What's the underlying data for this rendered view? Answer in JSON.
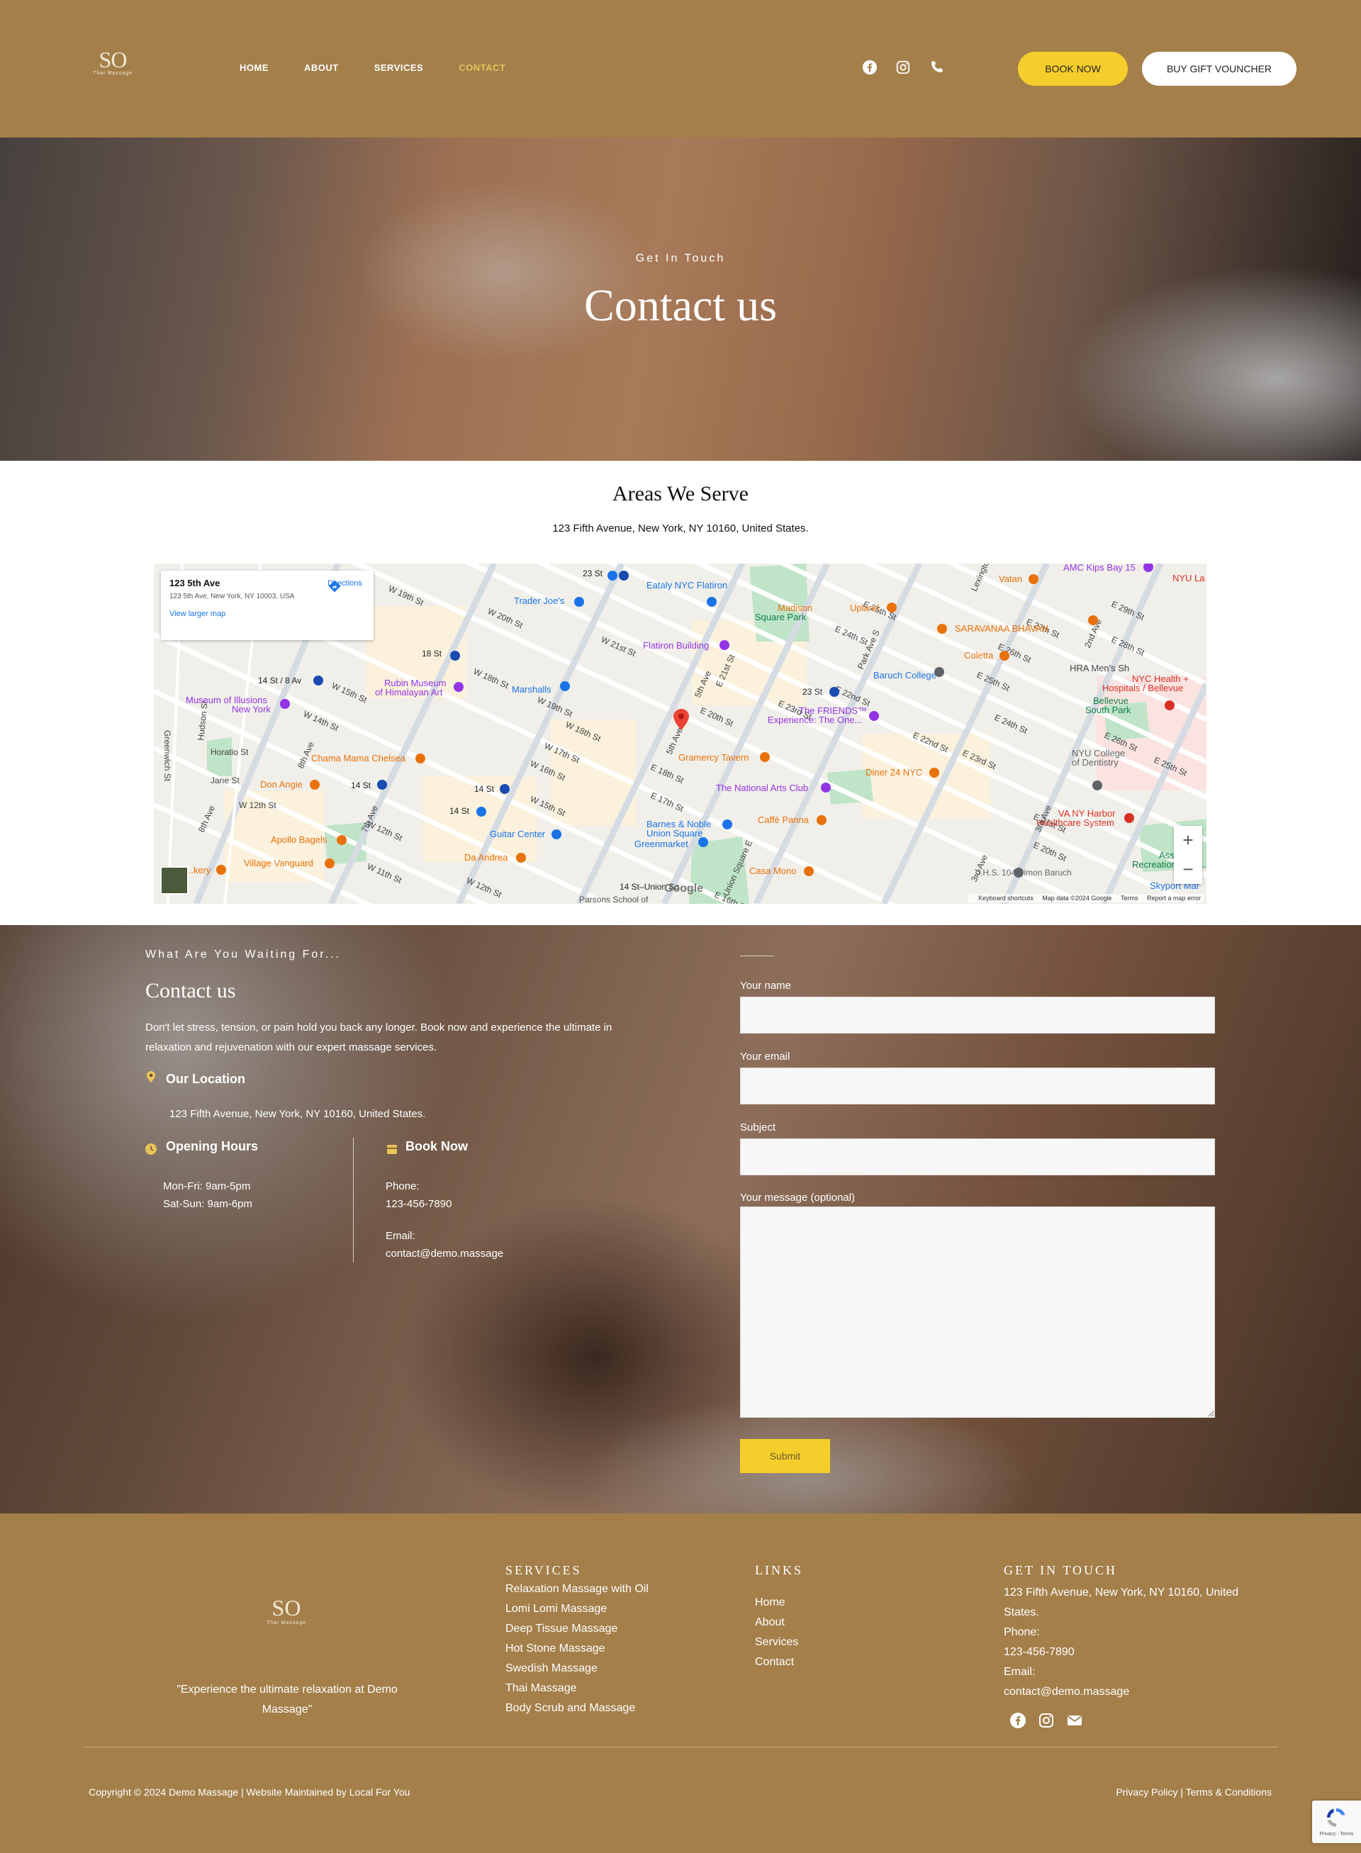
{
  "brand": {
    "monogram": "SO",
    "tagline": "Thai Massage"
  },
  "nav": {
    "items": [
      {
        "label": "HOME",
        "active": false
      },
      {
        "label": "ABOUT",
        "active": false
      },
      {
        "label": "SERVICES",
        "active": false
      },
      {
        "label": "CONTACT",
        "active": true
      }
    ]
  },
  "header_icons": [
    "facebook-icon",
    "instagram-icon",
    "phone-icon"
  ],
  "header_buttons": {
    "book": "BOOK NOW",
    "gift": "BUY GIFT VOUNCHER"
  },
  "hero": {
    "eyebrow": "Get In Touch",
    "title": "Contact us"
  },
  "areas": {
    "title": "Areas We Serve",
    "address": "123 Fifth Avenue, New York, NY 10160, United States."
  },
  "map": {
    "card_title": "123 5th Ave",
    "card_address": "123 5th Ave, New York, NY 10003, USA",
    "view_larger": "View larger map",
    "directions": "Directions",
    "zoom_in": "+",
    "zoom_out": "−",
    "brand": "Google",
    "footer": {
      "shortcuts": "Keyboard shortcuts",
      "data": "Map data ©2024 Google",
      "terms": "Terms",
      "report": "Report a map error"
    },
    "places": [
      "Trader Joe's",
      "Eataly NYC Flatiron",
      "Madison Square Park",
      "Flatiron Building",
      "Upland",
      "SARAVANAA BHAVAN",
      "Vatan",
      "Coletta",
      "Baruch College",
      "Marshalls",
      "Rubin Museum of Himalayan Art",
      "Museum of Illusions New York",
      "The FRIENDS™ Experience: The One...",
      "Gramercy Tavern",
      "Chama Mama Chelsea",
      "Don Angie",
      "Diner 24 NYC",
      "The National Arts Club",
      "Barnes & Noble",
      "Guitar Center",
      "Union Square Greenmarket",
      "Caffè Panna",
      "Apollo Bagels",
      "Da Andrea",
      "Village Vanguard",
      "Casa Mono",
      "J.H.S. 104 Simon Baruch",
      "NYU College of Dentistry",
      "VA NY Harbor Healthcare System",
      "NYC Health + Hospitals / Bellevue",
      "Bellevue South Park",
      "AMC Kips Bay 15",
      "HRA Men's Sh",
      "NYU La",
      "Asser Levy Recreation Center",
      "Skyport Mar",
      "Parsons School of",
      "14 St–Union Sq"
    ],
    "streets": [
      "W 19th St",
      "W 20th St",
      "W 21st St",
      "W 15th St",
      "W 14th St",
      "W 12th St",
      "W 11th St",
      "W 16th St",
      "W 17th St",
      "W 18th St",
      "E 20th St",
      "E 21st St",
      "E 22nd St",
      "E 23rd St",
      "E 24th St",
      "E 25th St",
      "E 26th St",
      "E 27th St",
      "E 28th St",
      "E 29th St",
      "E 16th St",
      "E 17th St",
      "E 18th St",
      "E 19th St",
      "5th Ave",
      "Park Ave S",
      "Lexington",
      "2nd Ave",
      "3rd Ave",
      "8th Ave",
      "7th Ave",
      "Greenwich St",
      "Hudson St",
      "Horatio St",
      "Jane St",
      "Union Square E"
    ],
    "stations": [
      "23 St",
      "18 St",
      "14 St / 8 Av",
      "14 St",
      "23 St"
    ]
  },
  "contact": {
    "eyebrow": "What Are You Waiting For...",
    "title": "Contact us",
    "text": "Don't let stress, tension, or pain hold you back any longer. Book now and experience the ultimate in relaxation and rejuvenation with our expert massage services.",
    "location_title": "Our Location",
    "location": "123 Fifth Avenue, New York, NY 10160, United States.",
    "hours_title": "Opening Hours",
    "hours": [
      "Mon-Fri: 9am-5pm",
      "Sat-Sun: 9am-6pm"
    ],
    "book_title": "Book Now",
    "phone_label": "Phone:",
    "phone": "123-456-7890",
    "email_label": "Email:",
    "email": "contact@demo.massage"
  },
  "form": {
    "name_label": "Your name",
    "name_value": "",
    "email_label": "Your email",
    "email_value": "",
    "subject_label": "Subject",
    "subject_value": "",
    "message_label": "Your message (optional)",
    "message_value": "",
    "submit": "Submit"
  },
  "footer": {
    "quote": "\"Experience the ultimate relaxation at Demo Massage\"",
    "services_title": "SERVICES",
    "services": [
      "Relaxation Massage with Oil",
      "Lomi Lomi Massage",
      "Deep Tissue Massage",
      "Hot Stone Massage",
      "Swedish Massage",
      "Thai Massage",
      "Body Scrub and Massage"
    ],
    "links_title": "LINKS",
    "links": [
      "Home",
      "About",
      "Services",
      "Contact"
    ],
    "get_title": "GET IN TOUCH",
    "address": "123 Fifth Avenue, New York, NY 10160, United States.",
    "phone_label": "Phone:",
    "phone": "123-456-7890",
    "email_label": "Email:",
    "email": "contact@demo.massage",
    "social_icons": [
      "facebook-icon",
      "instagram-icon",
      "envelope-icon"
    ],
    "copyright": "Copyright © 2024 Demo Massage | Website Maintained by Local For You",
    "legal": "Privacy Policy | Terms & Conditions"
  },
  "recaptcha": {
    "text": "Privacy - Terms"
  },
  "colors": {
    "brand_brown": "#a47f4a",
    "accent_yellow": "#f6ce2c",
    "active_nav": "#e4c35a"
  }
}
